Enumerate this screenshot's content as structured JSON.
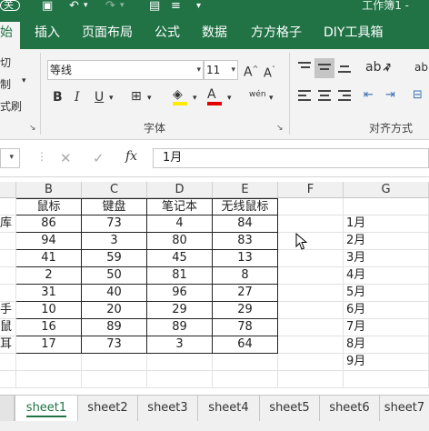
{
  "titlebar": {
    "autosave_label": "关",
    "title": "工作簿1 -"
  },
  "ribbon_tabs": [
    "始",
    "插入",
    "页面布局",
    "公式",
    "数据",
    "方方格子",
    "DIY工具箱"
  ],
  "ribbon": {
    "clipboard": {
      "cut": "切",
      "copy": "制",
      "painter": "式刷"
    },
    "font": {
      "font_name": "等线",
      "font_size": "11",
      "bold": "B",
      "italic": "I",
      "underline": "U",
      "grow": "A",
      "shrink": "A",
      "font_color": "A",
      "phonetic": "wén",
      "group_label": "字体"
    },
    "alignment": {
      "group_label": "对齐方式"
    }
  },
  "formula_bar": {
    "cancel": "✕",
    "enter": "✓",
    "fx": "fx",
    "value": "1月"
  },
  "columns": [
    "B",
    "C",
    "D",
    "E",
    "F",
    "G"
  ],
  "table": {
    "headers": [
      "鼠标",
      "键盘",
      "笔记本",
      "无线鼠标"
    ],
    "row_label_fragments": [
      "库",
      "",
      "",
      "",
      "",
      "手",
      "鼠",
      "耳"
    ],
    "rows": [
      [
        "86",
        "73",
        "4",
        "84"
      ],
      [
        "94",
        "3",
        "80",
        "83"
      ],
      [
        "41",
        "59",
        "45",
        "13"
      ],
      [
        "2",
        "50",
        "81",
        "8"
      ],
      [
        "31",
        "40",
        "96",
        "27"
      ],
      [
        "10",
        "20",
        "29",
        "29"
      ],
      [
        "16",
        "89",
        "89",
        "78"
      ],
      [
        "17",
        "73",
        "3",
        "64"
      ]
    ]
  },
  "months": [
    "1月",
    "2月",
    "3月",
    "4月",
    "5月",
    "6月",
    "7月",
    "8月",
    "9月"
  ],
  "sheets": [
    "sheet1",
    "sheet2",
    "sheet3",
    "sheet4",
    "sheet5",
    "sheet6",
    "sheet7"
  ],
  "colors": {
    "excel_green": "#217346",
    "highlight_yellow": "#ffeb00",
    "font_red": "#e00000"
  }
}
